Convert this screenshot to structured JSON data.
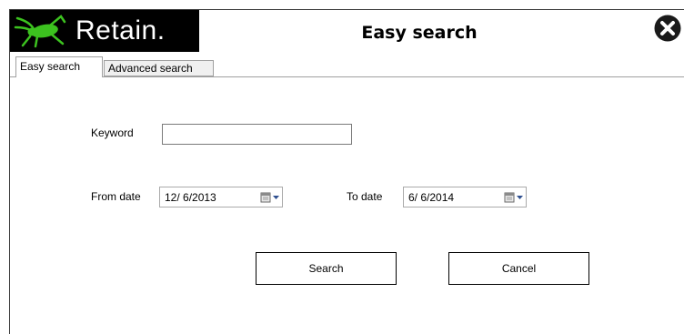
{
  "brand": {
    "name": "Retain."
  },
  "window": {
    "title": "Easy search"
  },
  "tabs": [
    {
      "label": "Easy search",
      "active": true
    },
    {
      "label": "Advanced search",
      "active": false
    }
  ],
  "form": {
    "keyword": {
      "label": "Keyword",
      "value": ""
    },
    "from_date": {
      "label": "From date",
      "value": "12/ 6/2013"
    },
    "to_date": {
      "label": "To date",
      "value": "6/ 6/2014"
    }
  },
  "buttons": {
    "search": "Search",
    "cancel": "Cancel"
  },
  "icons": {
    "logo": "cricket-icon",
    "close": "close-circle-icon",
    "calendar": "calendar-dropdown-icon"
  },
  "colors": {
    "logo_bg": "#000000",
    "brand_green": "#3cc21f",
    "text": "#000000"
  }
}
